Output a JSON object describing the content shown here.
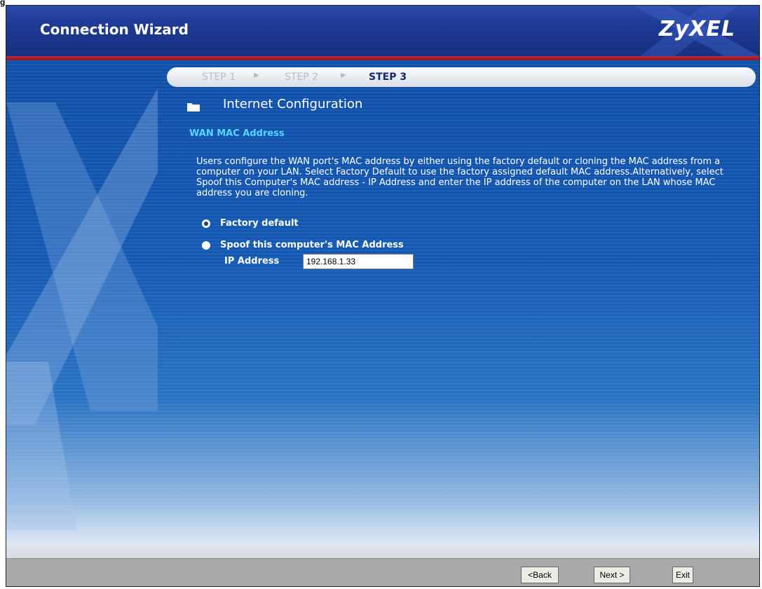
{
  "header": {
    "title": "Connection Wizard",
    "brand": "ZyXEL"
  },
  "steps": {
    "step1": "STEP 1",
    "step2": "STEP 2",
    "step3": "STEP 3"
  },
  "section_title": "Internet Configuration",
  "subsection_title": "WAN MAC Address",
  "description": "Users configure the WAN port's MAC address by either using the factory default or cloning the MAC address from a computer on your LAN. Select Factory Default to use the factory assigned default MAC address.Alternatively, select Spoof this Computer's MAC address - IP Address and enter the IP address of the computer on the LAN whose MAC address you are cloning.",
  "options": {
    "factory_default": "Factory default",
    "spoof": "Spoof this computer's MAC Address",
    "selected": "factory_default"
  },
  "ip_field": {
    "label": "IP Address",
    "value": "192.168.1.33"
  },
  "buttons": {
    "back": "<Back",
    "next": "Next >",
    "exit": "Exit"
  }
}
